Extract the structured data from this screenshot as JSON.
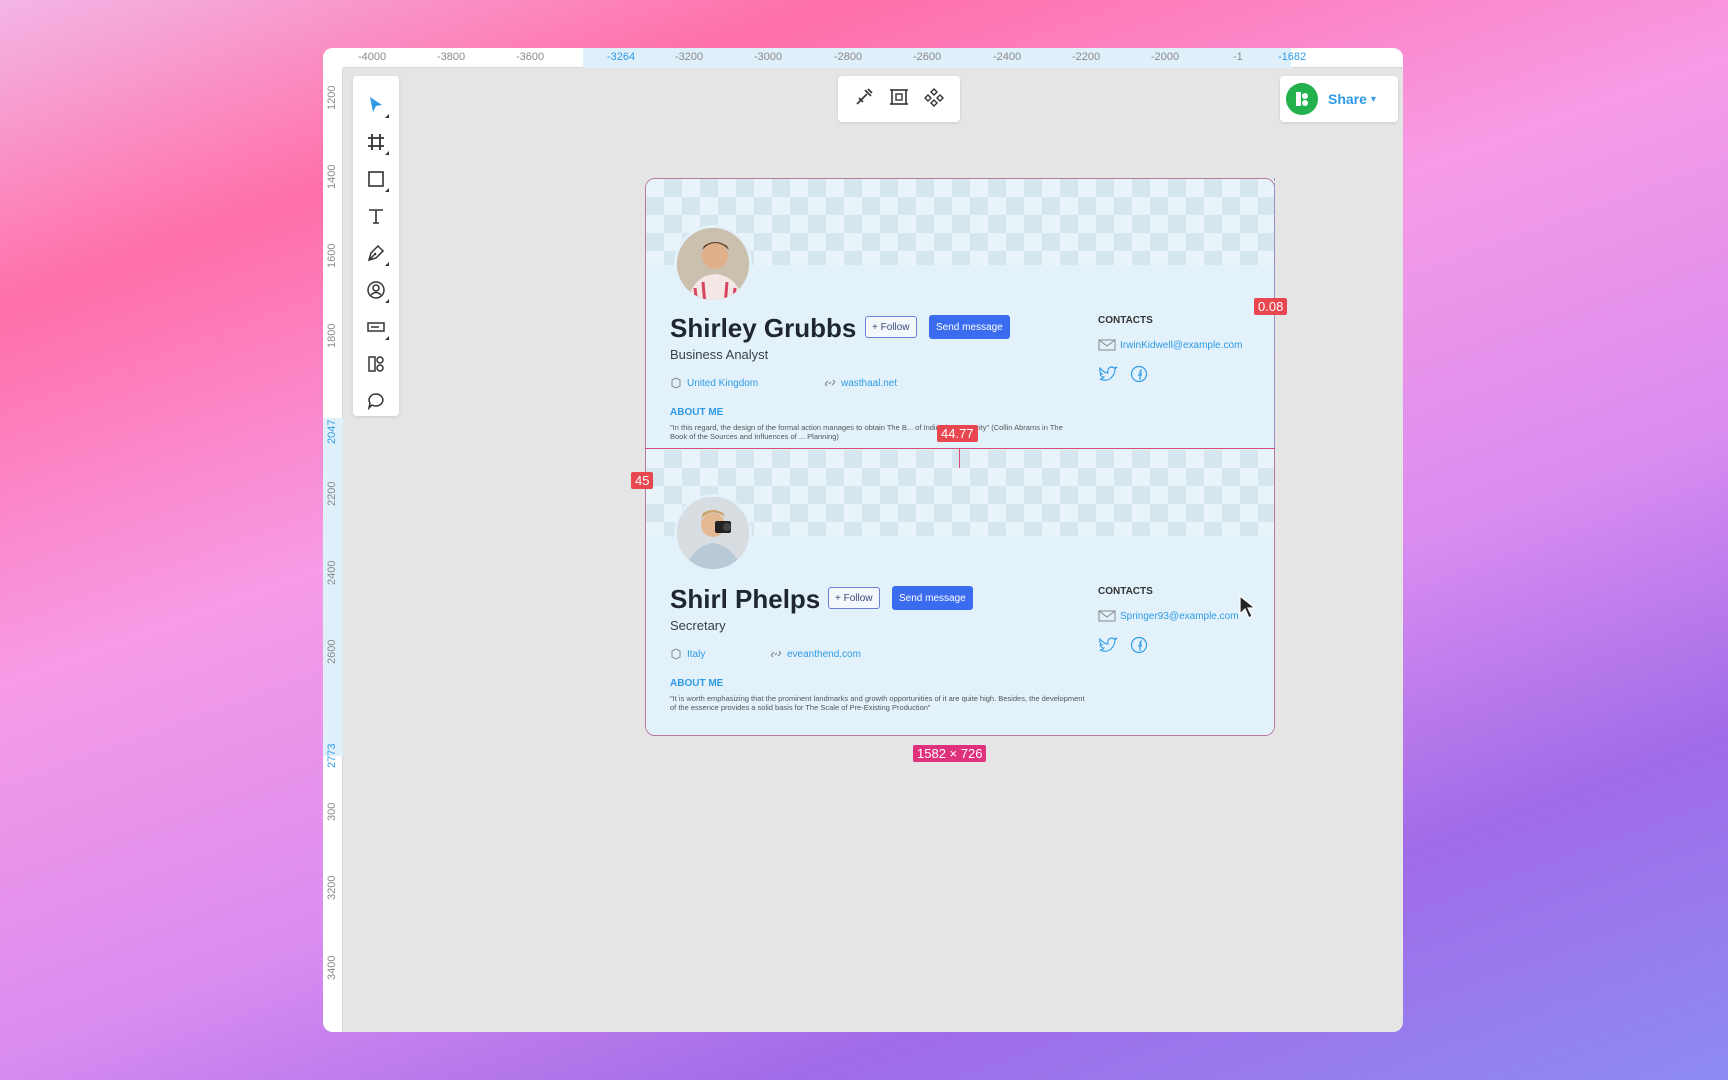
{
  "ruler": {
    "top_labels": [
      "-4000",
      "-3800",
      "-3600",
      "-3264",
      "-3200",
      "-3000",
      "-2800",
      "-2600",
      "-2400",
      "-2200",
      "-2000",
      "-1",
      "-1682"
    ],
    "left_labels": [
      "1200",
      "1400",
      "1600",
      "1800",
      "2047",
      "2200",
      "2400",
      "2600",
      "2773",
      "300",
      "3200",
      "3400"
    ]
  },
  "toolbar": {
    "tools": [
      "move-tool",
      "frame-tool",
      "rectangle-tool",
      "text-tool",
      "pen-tool",
      "avatar-tool",
      "input-tool",
      "components-tool",
      "comment-tool"
    ]
  },
  "share": {
    "label": "Share"
  },
  "cards": [
    {
      "name": "Shirley Grubbs",
      "role": "Business Analyst",
      "follow": "+ Follow",
      "send": "Send message",
      "location": "United Kingdom",
      "website": "wasthaal.net",
      "about_heading": "ABOUT ME",
      "about_text": "\"In this regard, the design of the formal action manages to obtain The B... of Indicative Capacity\" (Collin Abrams in The Book of the Sources and Influences of ... Planning)",
      "contacts_heading": "CONTACTS",
      "email": "IrwinKidwell@example.com"
    },
    {
      "name": "Shirl Phelps",
      "role": "Secretary",
      "follow": "+ Follow",
      "send": "Send message",
      "location": "Italy",
      "website": "eveanthend.com",
      "about_heading": "ABOUT ME",
      "about_text": "\"It is worth emphasizing that the prominent landmarks and growth opportunities of it are quite high. Besides, the development of the essence provides a solid basis for The Scale of Pre-Existing Production\"",
      "contacts_heading": "CONTACTS",
      "email": "Springer93@example.com"
    }
  ],
  "measurements": {
    "right_gap": "0.08",
    "center_gap": "44.77",
    "left_gap": "45",
    "size": "1582 × 726"
  },
  "colors": {
    "accent": "#2f9be6",
    "button": "#3b6cf0",
    "measure": "#e8474f",
    "size_tag": "#e0327c"
  }
}
